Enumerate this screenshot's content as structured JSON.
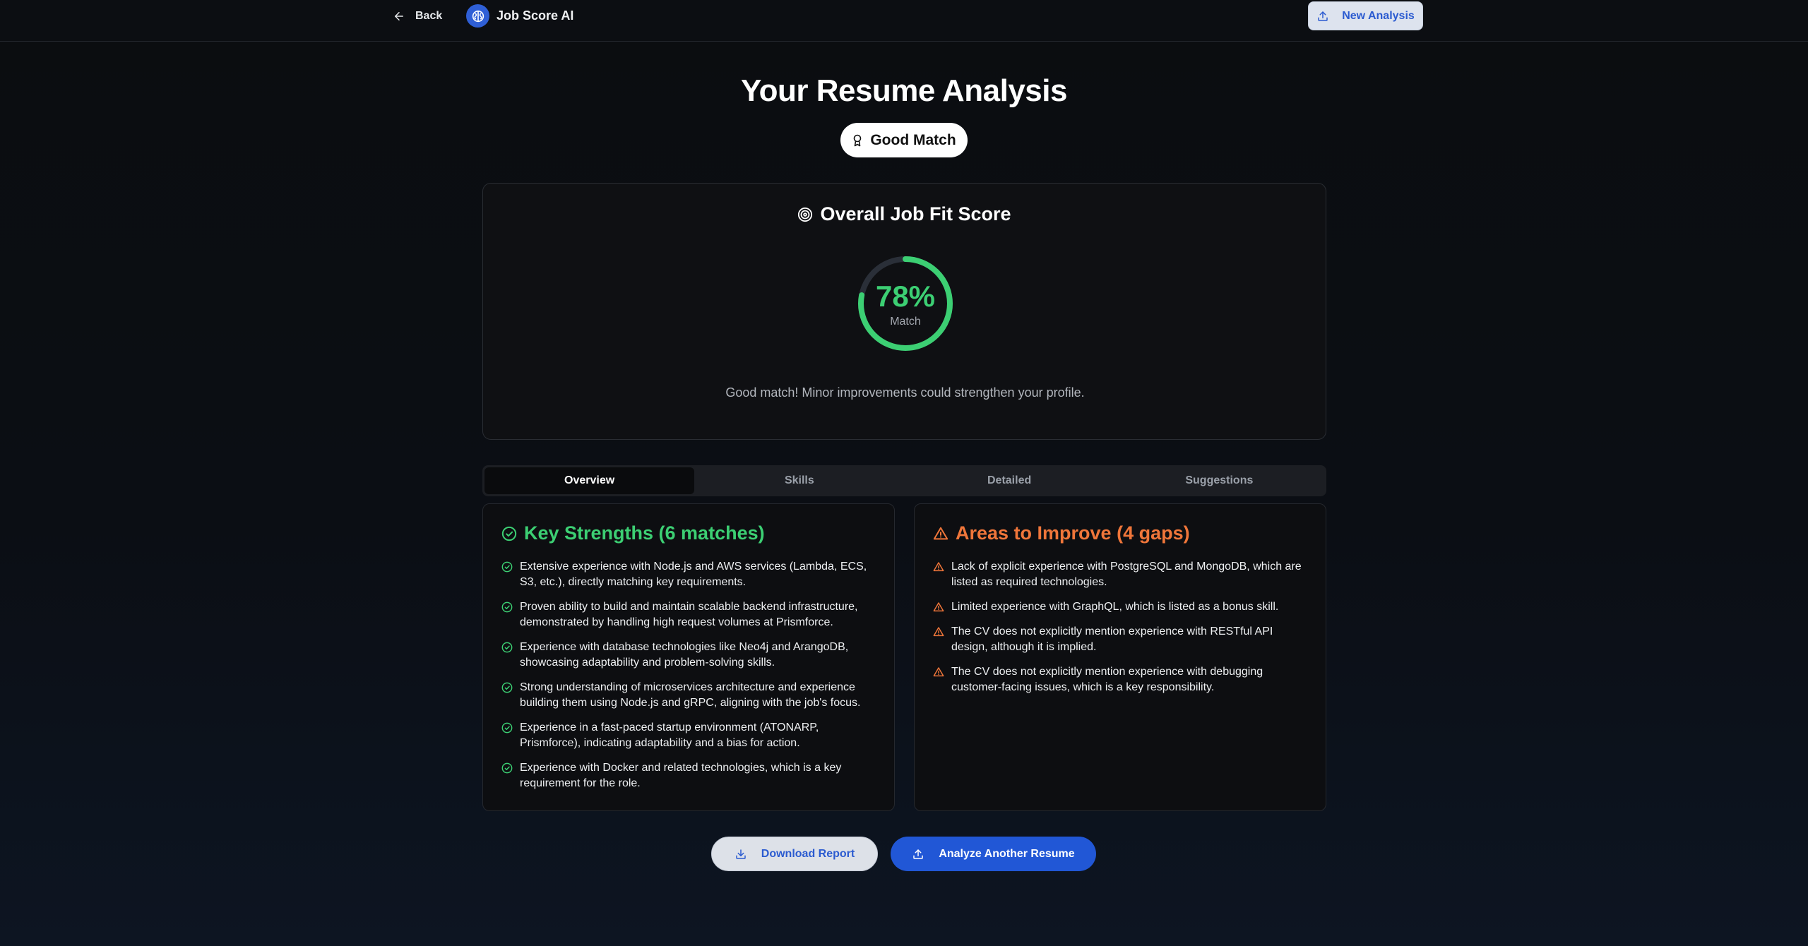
{
  "header": {
    "back_label": "Back",
    "brand_title": "Job Score AI",
    "new_analysis_label": "New Analysis"
  },
  "page": {
    "title": "Your Resume Analysis",
    "badge_label": "Good Match"
  },
  "score": {
    "heading": "Overall Job Fit Score",
    "value_label": "78%",
    "value": 0.78,
    "sub_label": "Match",
    "description": "Good match! Minor improvements could strengthen your profile.",
    "accent_color": "#3ccf73",
    "track_color": "#2a2f38"
  },
  "tabs": [
    {
      "label": "Overview",
      "active": true
    },
    {
      "label": "Skills",
      "active": false
    },
    {
      "label": "Detailed",
      "active": false
    },
    {
      "label": "Suggestions",
      "active": false
    }
  ],
  "strengths": {
    "title": "Key Strengths (6 matches)",
    "icon": "check-circle-icon",
    "color": "#3ccf73",
    "items": [
      "Extensive experience with Node.js and AWS services (Lambda, ECS, S3, etc.), directly matching key requirements.",
      "Proven ability to build and maintain scalable backend infrastructure, demonstrated by handling high request volumes at Prismforce.",
      "Experience with database technologies like Neo4j and ArangoDB, showcasing adaptability and problem-solving skills.",
      "Strong understanding of microservices architecture and experience building them using Node.js and gRPC, aligning with the job's focus.",
      "Experience in a fast-paced startup environment (ATONARP, Prismforce), indicating adaptability and a bias for action.",
      "Experience with Docker and related technologies, which is a key requirement for the role."
    ]
  },
  "improvements": {
    "title": "Areas to Improve (4 gaps)",
    "icon": "warning-triangle-icon",
    "color": "#f0763a",
    "items": [
      "Lack of explicit experience with PostgreSQL and MongoDB, which are listed as required technologies.",
      "Limited experience with GraphQL, which is listed as a bonus skill.",
      "The CV does not explicitly mention experience with RESTful API design, although it is implied.",
      "The CV does not explicitly mention experience with debugging customer-facing issues, which is a key responsibility."
    ]
  },
  "actions": {
    "download_label": "Download Report",
    "analyze_label": "Analyze Another Resume"
  }
}
